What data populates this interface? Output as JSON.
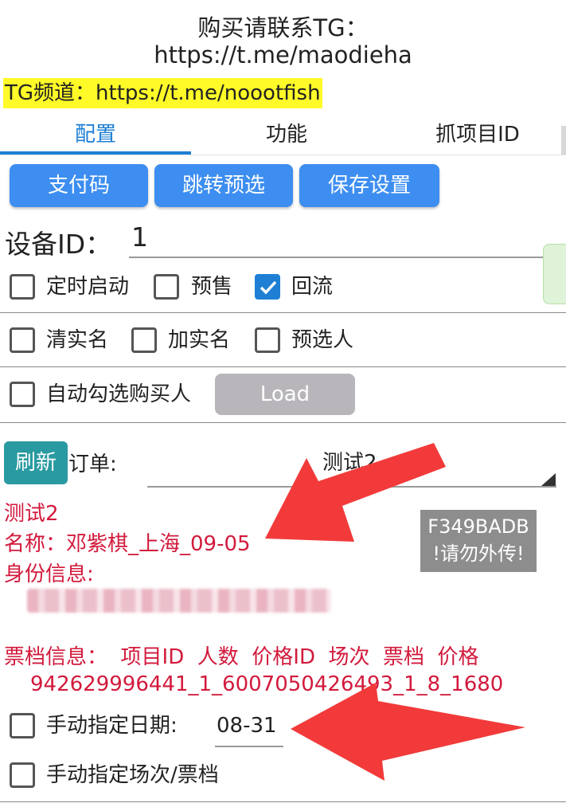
{
  "header": {
    "line1": "购买请联系TG：",
    "line2": "https://t.me/maodieha",
    "channel": "TG频道：https://t.me/noootfish"
  },
  "tabs": [
    {
      "label": "配置",
      "active": true
    },
    {
      "label": "功能",
      "active": false
    },
    {
      "label": "抓项目ID",
      "active": false
    }
  ],
  "toolbar": {
    "pay_code": "支付码",
    "jump_preselect": "跳转预选",
    "save_settings": "保存设置"
  },
  "device": {
    "label": "设备ID：",
    "value": "1"
  },
  "options_row1": [
    {
      "label": "定时启动",
      "checked": false
    },
    {
      "label": "预售",
      "checked": false
    },
    {
      "label": "回流",
      "checked": true
    }
  ],
  "options_row2": [
    {
      "label": "清实名",
      "checked": false
    },
    {
      "label": "加实名",
      "checked": false
    },
    {
      "label": "预选人",
      "checked": false
    }
  ],
  "auto_select": {
    "label": "自动勾选购买人",
    "checked": false
  },
  "load_button": "Load",
  "order": {
    "refresh": "刷新",
    "label": "订单:",
    "selected": "测试2"
  },
  "info": {
    "line1": "测试2",
    "name": "名称：邓紫棋_上海_09-05",
    "identity_label": "身份信息:",
    "ticket_header": "票档信息：  项目ID  人数  价格ID  场次  票档  价格",
    "ticket_value": "942629996441_1_6007050426493_1_8_1680"
  },
  "watermark": {
    "line1": "F349BADB",
    "line2": "!请勿外传!"
  },
  "manual_date": {
    "label": "手动指定日期:",
    "value": "08-31",
    "checked": false
  },
  "manual_session": {
    "label": "手动指定场次/票档",
    "checked": false
  },
  "colors": {
    "accent": "#1e7fd4",
    "button": "#3d8ef0",
    "highlight": "#fffa28",
    "red_text": "#d21a3c",
    "arrow": "#f23a3a"
  }
}
